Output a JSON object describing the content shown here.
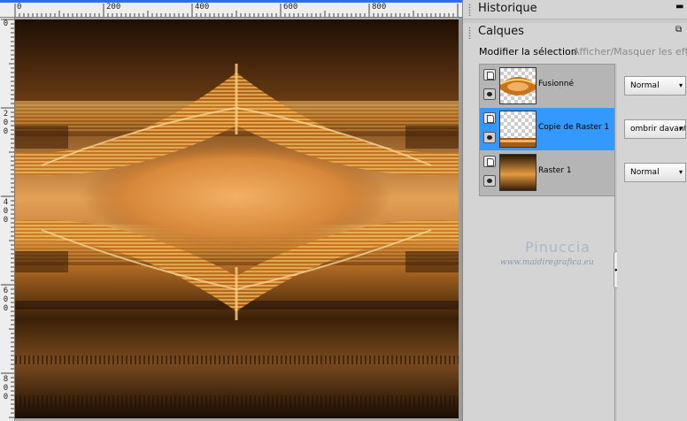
{
  "ruler": {
    "h_labels": [
      "0",
      "200",
      "400",
      "600",
      "800"
    ],
    "v_labels": [
      [
        "0"
      ],
      [
        "2",
        "0",
        "0"
      ],
      [
        "4",
        "0",
        "0"
      ],
      [
        "6",
        "0",
        "0"
      ],
      [
        "8",
        "0",
        "0"
      ]
    ]
  },
  "panels": {
    "history_title": "Historique",
    "layers_title": "Calques",
    "modify_selection": "Modifier la sélection",
    "show_hide_effects": "Afficher/Masquer les effets"
  },
  "layers": [
    {
      "name": "Fusionné",
      "blend": "Normal",
      "selected": false,
      "thumb": "merged"
    },
    {
      "name": "Copie de Raster 1",
      "blend": "ombrir davant…",
      "selected": true,
      "thumb": "copy"
    },
    {
      "name": "Raster 1",
      "blend": "Normal",
      "selected": false,
      "thumb": "raster"
    }
  ],
  "watermark": {
    "name": "Pinuccia",
    "url": "www.maidiregrafica.eu"
  },
  "colors": {
    "selection": "#3399ff",
    "ruler_accent": "#2e6ee8",
    "artwork_orange": "#e39a40",
    "artwork_dark": "#2a1606"
  },
  "icons": {
    "layer_page": "layer-page-icon",
    "visibility": "eye-icon",
    "float": "float-panel-icon",
    "minimize": "minimize-icon",
    "dropdown": "dropdown-arrow-icon"
  }
}
